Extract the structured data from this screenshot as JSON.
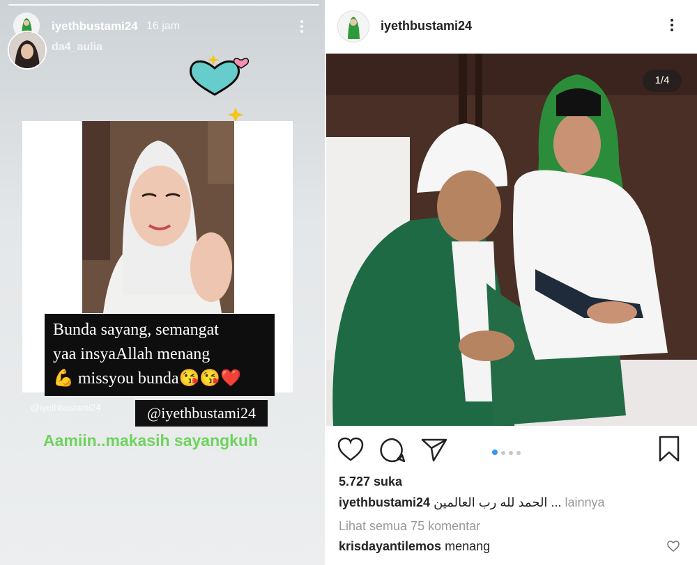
{
  "story": {
    "username": "iyethbustami24",
    "time": "16 jam",
    "repost_user": "da4_aulia",
    "quote_lines": [
      "Bunda sayang, semangat",
      "yaa insyaAllah menang",
      "💪 missyou bunda😘😘❤️"
    ],
    "watermark": "@iyethbustami24",
    "mention": "@iyethbustami24",
    "reply": "Aamiin..makasih sayangkuh"
  },
  "post": {
    "username": "iyethbustami24",
    "counter": "1/4",
    "likes": "5.727 suka",
    "caption_user": "iyethbustami24",
    "caption_text": "الحمد لله رب العالمين ...",
    "caption_more": "lainnya",
    "view_comments": "Lihat semua 75 komentar",
    "comment_user": "krisdayantilemos",
    "comment_text": "menang"
  },
  "icons": [
    "heart-icon",
    "comment-icon",
    "share-icon",
    "bookmark-icon",
    "more-icon"
  ],
  "colors": {
    "reply_green": "#6fd35d",
    "active_dot": "#3897f0"
  }
}
